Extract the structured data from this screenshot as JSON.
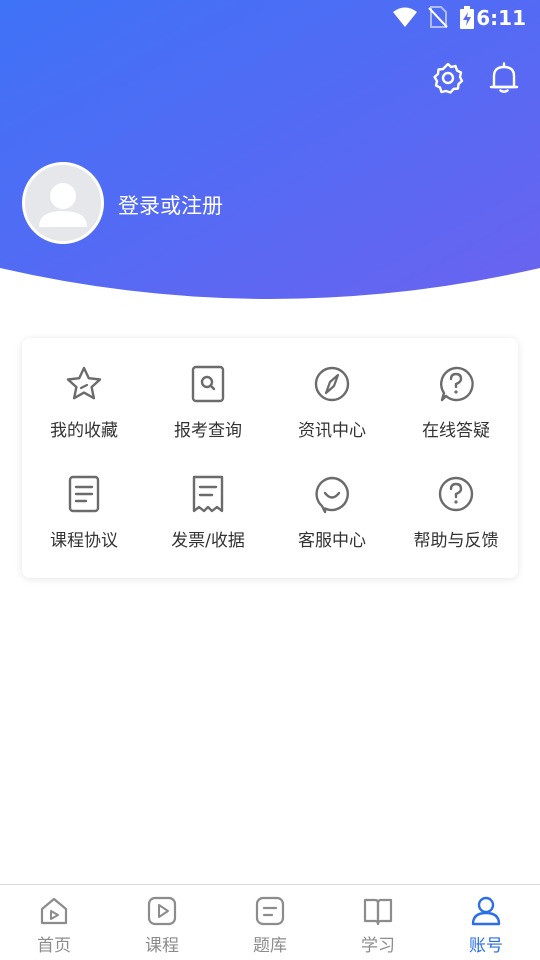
{
  "status_bar": {
    "time": "6:11"
  },
  "header": {
    "login_text": "登录或注册",
    "gradient_start": "#3f71f6",
    "gradient_end": "#6a63f0"
  },
  "menu": {
    "items": [
      {
        "label": "我的收藏",
        "icon": "star-icon"
      },
      {
        "label": "报考查询",
        "icon": "document-search-icon"
      },
      {
        "label": "资讯中心",
        "icon": "compass-icon"
      },
      {
        "label": "在线答疑",
        "icon": "question-bubble-icon"
      },
      {
        "label": "课程协议",
        "icon": "document-lines-icon"
      },
      {
        "label": "发票/收据",
        "icon": "receipt-icon"
      },
      {
        "label": "客服中心",
        "icon": "smile-bubble-icon"
      },
      {
        "label": "帮助与反馈",
        "icon": "help-circle-icon"
      }
    ]
  },
  "tabbar": {
    "active_color": "#2a6fe6",
    "tabs": [
      {
        "label": "首页",
        "icon": "home-icon"
      },
      {
        "label": "课程",
        "icon": "play-icon"
      },
      {
        "label": "题库",
        "icon": "question-bank-icon"
      },
      {
        "label": "学习",
        "icon": "book-icon"
      },
      {
        "label": "账号",
        "icon": "user-icon",
        "active": true
      }
    ]
  }
}
